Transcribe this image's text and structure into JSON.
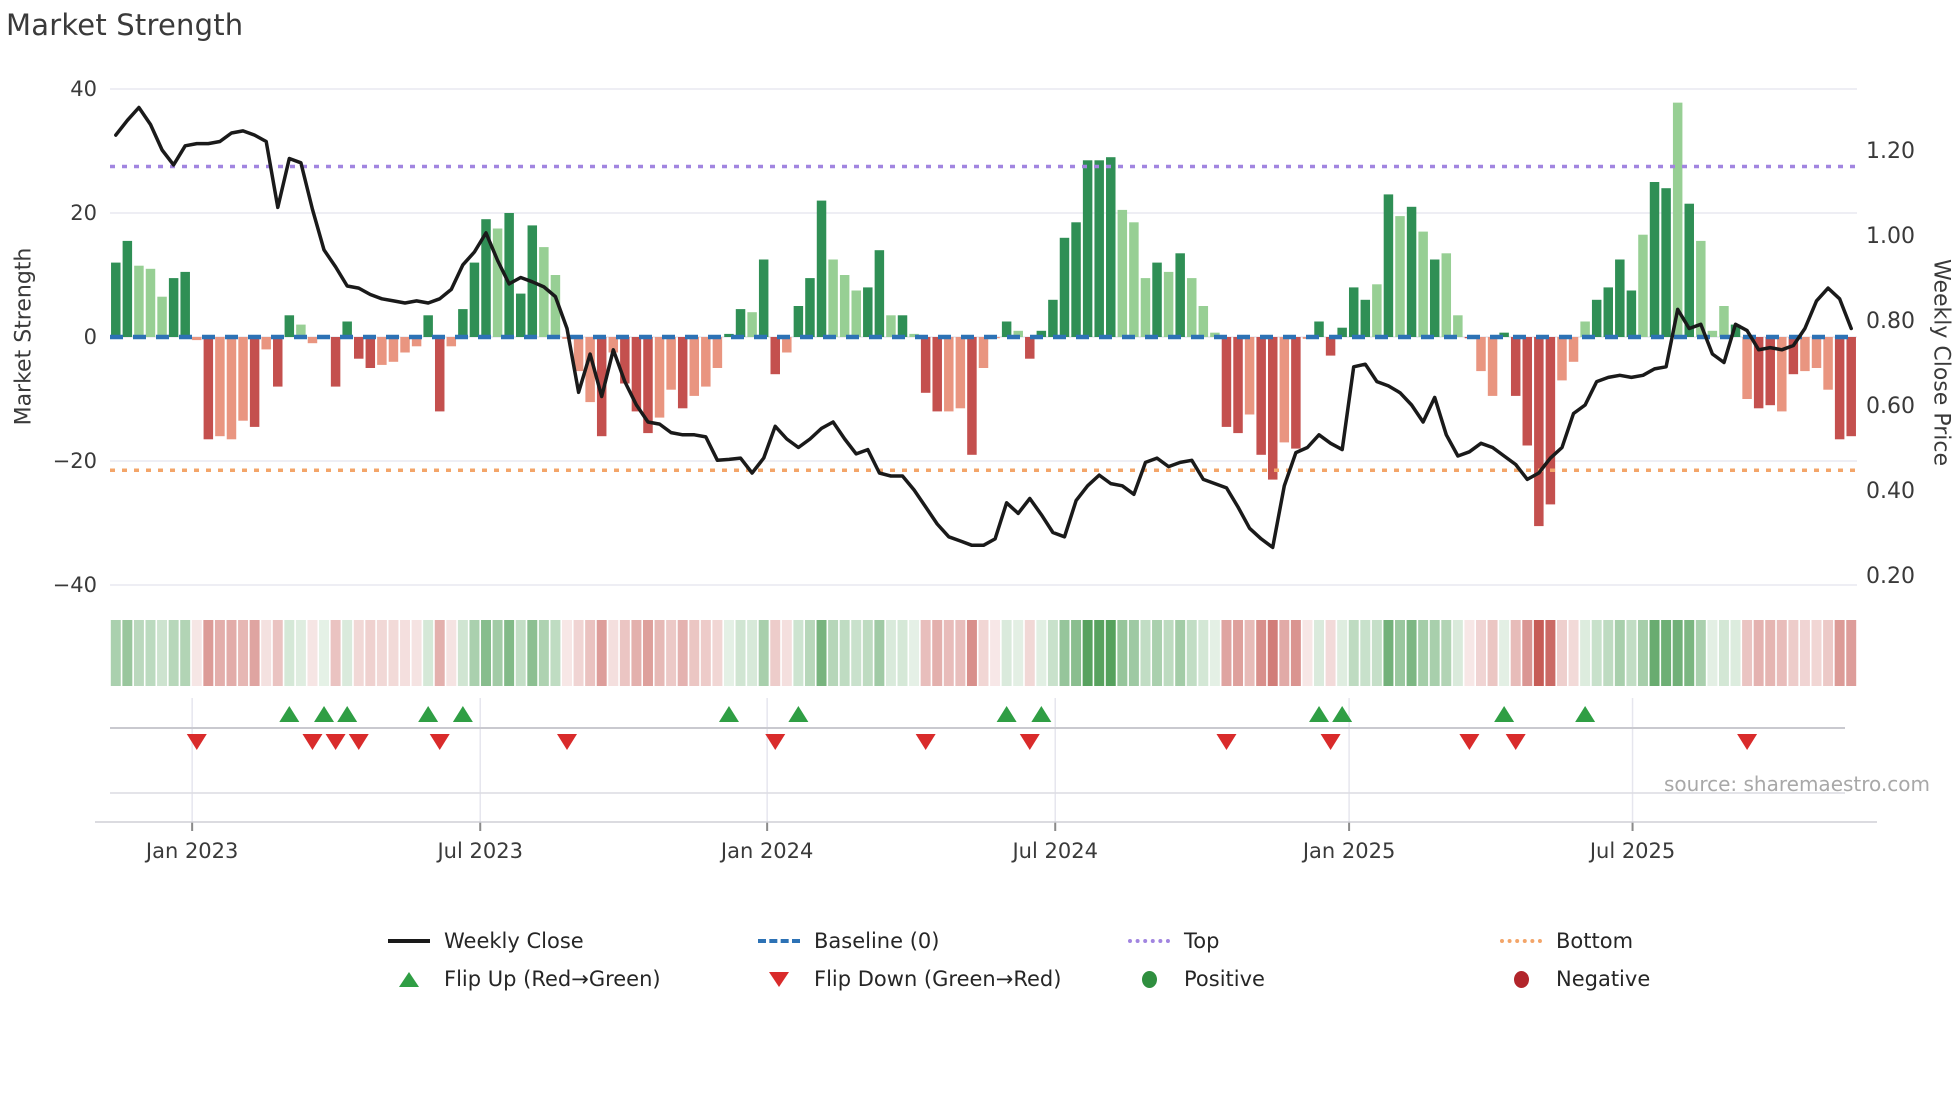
{
  "page": {
    "title": "Market Strength",
    "source": "source: sharemaestro.com"
  },
  "legend": {
    "weekly_close": "Weekly Close",
    "baseline": "Baseline (0)",
    "top": "Top",
    "bottom": "Bottom",
    "flip_up": "Flip Up (Red→Green)",
    "flip_down": "Flip Down (Green→Red)",
    "positive": "Positive",
    "negative": "Negative"
  },
  "colors": {
    "pos_strong": "#2f8f55",
    "pos_light": "#97cf94",
    "neg_strong": "#c4504e",
    "neg_light": "#e99580",
    "price_line": "#1a1a1a",
    "baseline": "#2d72b5",
    "top_line": "#a185e0",
    "bottom_line": "#f3a569",
    "flip_up": "#2f9e44",
    "flip_down": "#d92b2b",
    "grid": "#e8e8f0",
    "axis_text": "#3a3a3a",
    "marker_axis": "#c9c9cf"
  },
  "chart_data": {
    "type": [
      "bar",
      "line",
      "heatmap"
    ],
    "title": "Market Strength",
    "xlabel": "",
    "ylabel_left": "Market Strength",
    "ylabel_right": "Weekly Close Price",
    "x_axis": {
      "tick_labels": [
        "Jan 2023",
        "Jul 2023",
        "Jan 2024",
        "Jul 2024",
        "Jan 2025",
        "Jul 2025"
      ],
      "tick_weeks": [
        6.6,
        31.5,
        56.3,
        81.2,
        106.6,
        131.1
      ],
      "unit": "weekly"
    },
    "left_axis": {
      "label": "Market Strength",
      "ylim": [
        -44,
        46
      ],
      "tick_values": [
        40,
        20,
        0,
        -20,
        -40
      ],
      "tick_labels": [
        "40",
        "20",
        "0",
        "−20",
        "−40"
      ]
    },
    "right_axis": {
      "label": "Weekly Close Price",
      "ylim": [
        0.15,
        1.38
      ],
      "tick_values": [
        1.2,
        1.0,
        0.8,
        0.6,
        0.4,
        0.2
      ],
      "tick_labels": [
        "1.20",
        "1.00",
        "0.80",
        "0.60",
        "0.40",
        "0.20"
      ]
    },
    "baseline_level": 0,
    "top_level": 27.5,
    "bottom_level": -21.5,
    "grid_levels": [
      40,
      20,
      0,
      -20,
      -40
    ],
    "strength": [
      12,
      15.5,
      11.5,
      11,
      6.5,
      9.5,
      10.5,
      -0.5,
      -16.5,
      -16,
      -16.5,
      -13.5,
      -14.5,
      -2,
      -8,
      3.5,
      2,
      -1,
      0.3,
      -8,
      2.5,
      -3.5,
      -5,
      -4.5,
      -4,
      -2.5,
      -1.5,
      3.5,
      -12,
      -1.5,
      4.5,
      12,
      19,
      17.5,
      20,
      7,
      18,
      14.5,
      10,
      -0.3,
      -5.5,
      -10.5,
      -16,
      -2.5,
      -7.5,
      -12,
      -15.5,
      -13,
      -8.5,
      -11.5,
      -9.5,
      -8,
      -5,
      0.5,
      4.5,
      4,
      12.5,
      -6,
      -2.5,
      5,
      9.5,
      22,
      12.5,
      10,
      7.5,
      8,
      14,
      3.5,
      3.5,
      0.5,
      -9,
      -12,
      -12,
      -11.5,
      -19,
      -5,
      -0.2,
      2.5,
      1,
      -3.5,
      1,
      6,
      16,
      18.5,
      28.5,
      28.5,
      29,
      20.5,
      18.5,
      9.5,
      12,
      10.5,
      13.5,
      9.5,
      5,
      0.7,
      -14.5,
      -15.5,
      -12.5,
      -19,
      -23,
      -17,
      -18,
      -0.3,
      2.5,
      -3,
      1.5,
      8,
      6,
      8.5,
      23,
      19.5,
      21,
      17,
      12.5,
      13.5,
      3.5,
      -0.2,
      -5.5,
      -9.5,
      0.7,
      -9.5,
      -17.5,
      -30.5,
      -27,
      -7,
      -4,
      2.5,
      6,
      8,
      12.5,
      7.5,
      16.5,
      25,
      24,
      37.8,
      21.5,
      15.5,
      1,
      5,
      2,
      -10,
      -11.5,
      -11,
      -12,
      -6,
      -5.5,
      -5,
      -8.5,
      -16.5,
      -16
    ],
    "tone": "ddlllddldllldlddllddddDllllddlddDldddllllldldddlldlllddlddldddlllddldlddlldlldlddddddddllldldlllddlddldldddddldldldlldlldddddlllddddlddldllldlddldlllddl",
    "price": [
      1.235,
      1.27,
      1.3,
      1.26,
      1.2,
      1.165,
      1.21,
      1.215,
      1.215,
      1.22,
      1.24,
      1.245,
      1.235,
      1.22,
      1.065,
      1.18,
      1.17,
      1.06,
      0.965,
      0.925,
      0.88,
      0.875,
      0.86,
      0.85,
      0.845,
      0.84,
      0.845,
      0.84,
      0.85,
      0.872,
      0.93,
      0.96,
      1.005,
      0.94,
      0.885,
      0.9,
      0.89,
      0.878,
      0.855,
      0.78,
      0.63,
      0.72,
      0.62,
      0.73,
      0.655,
      0.6,
      0.56,
      0.555,
      0.535,
      0.53,
      0.53,
      0.525,
      0.47,
      0.472,
      0.475,
      0.44,
      0.475,
      0.55,
      0.52,
      0.5,
      0.52,
      0.545,
      0.56,
      0.52,
      0.485,
      0.495,
      0.44,
      0.433,
      0.433,
      0.4,
      0.36,
      0.32,
      0.29,
      0.28,
      0.27,
      0.27,
      0.285,
      0.37,
      0.345,
      0.38,
      0.342,
      0.3,
      0.29,
      0.375,
      0.41,
      0.435,
      0.415,
      0.41,
      0.39,
      0.465,
      0.475,
      0.455,
      0.465,
      0.47,
      0.425,
      0.415,
      0.405,
      0.36,
      0.31,
      0.285,
      0.265,
      0.41,
      0.488,
      0.5,
      0.53,
      0.51,
      0.495,
      0.69,
      0.696,
      0.655,
      0.645,
      0.629,
      0.6,
      0.56,
      0.618,
      0.53,
      0.48,
      0.49,
      0.51,
      0.5,
      0.48,
      0.46,
      0.425,
      0.44,
      0.475,
      0.5,
      0.58,
      0.6,
      0.655,
      0.665,
      0.67,
      0.665,
      0.67,
      0.685,
      0.69,
      0.825,
      0.78,
      0.79,
      0.72,
      0.7,
      0.79,
      0.775,
      0.73,
      0.735,
      0.73,
      0.74,
      0.78,
      0.845,
      0.875,
      0.85,
      0.78
    ],
    "flip_up_weeks": [
      15,
      18,
      20,
      27,
      30,
      53,
      59,
      77,
      80,
      104,
      106,
      120,
      127
    ],
    "flip_down_weeks": [
      7,
      17,
      19,
      21,
      28,
      39,
      57,
      70,
      79,
      96,
      105,
      117,
      121,
      141
    ],
    "legend_position": "bottom",
    "grid": "horizontal-faint"
  }
}
